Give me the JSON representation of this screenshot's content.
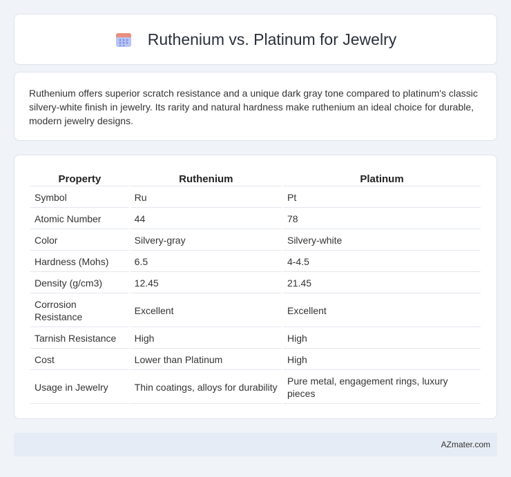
{
  "header": {
    "title": "Ruthenium vs. Platinum for Jewelry",
    "icon": "calendar-icon",
    "icon_colors": {
      "top": "#e98f7d",
      "body": "#a6b6f2",
      "dots": "#7c8fe0"
    }
  },
  "intro": {
    "text": "Ruthenium offers superior scratch resistance and a unique dark gray tone compared to platinum's classic silvery-white finish in jewelry. Its rarity and natural hardness make ruthenium an ideal choice for durable, modern jewelry designs."
  },
  "table": {
    "headers": [
      "Property",
      "Ruthenium",
      "Platinum"
    ],
    "rows": [
      [
        "Symbol",
        "Ru",
        "Pt"
      ],
      [
        "Atomic Number",
        "44",
        "78"
      ],
      [
        "Color",
        "Silvery-gray",
        "Silvery-white"
      ],
      [
        "Hardness (Mohs)",
        "6.5",
        "4-4.5"
      ],
      [
        "Density (g/cm3)",
        "12.45",
        "21.45"
      ],
      [
        "Corrosion Resistance",
        "Excellent",
        "Excellent"
      ],
      [
        "Tarnish Resistance",
        "High",
        "High"
      ],
      [
        "Cost",
        "Lower than Platinum",
        "High"
      ],
      [
        "Usage in Jewelry",
        "Thin coatings, alloys for durability",
        "Pure metal, engagement rings, luxury pieces"
      ]
    ]
  },
  "footer": {
    "text": "AZmater.com"
  }
}
